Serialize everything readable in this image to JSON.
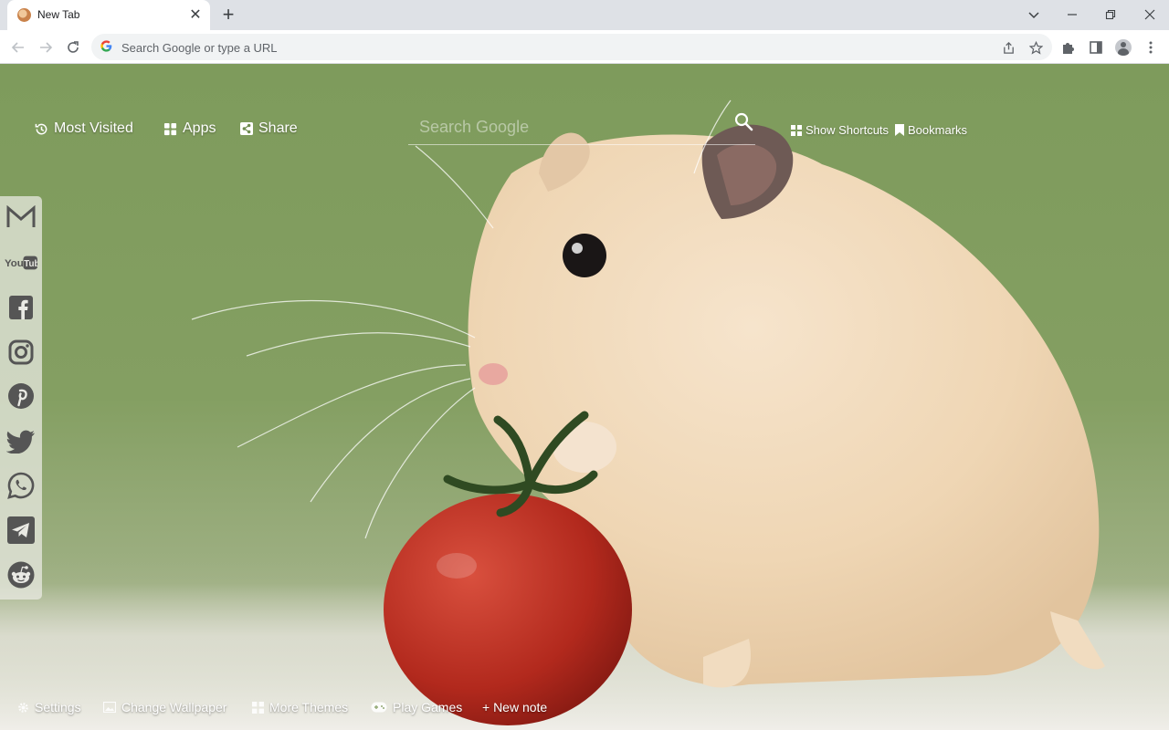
{
  "tab": {
    "title": "New Tab",
    "close": "✕"
  },
  "newtab": {
    "label": "+"
  },
  "omnibox": {
    "placeholder": "Search Google or type a URL",
    "logo": "G"
  },
  "topnav": {
    "most_visited": "Most Visited",
    "apps": "Apps",
    "share": "Share"
  },
  "search": {
    "placeholder": "Search Google"
  },
  "rightnav": {
    "show_shortcuts": "Show Shortcuts",
    "bookmarks": "Bookmarks"
  },
  "sidebar": {
    "items": [
      {
        "name": "gmail",
        "icon": "gmail-icon",
        "label": "M"
      },
      {
        "name": "youtube",
        "icon": "youtube-icon",
        "label": "YouTube"
      },
      {
        "name": "facebook",
        "icon": "facebook-icon",
        "label": "f"
      },
      {
        "name": "instagram",
        "icon": "instagram-icon"
      },
      {
        "name": "pinterest",
        "icon": "pinterest-icon",
        "label": "P"
      },
      {
        "name": "twitter",
        "icon": "twitter-icon"
      },
      {
        "name": "whatsapp",
        "icon": "whatsapp-icon"
      },
      {
        "name": "telegram",
        "icon": "telegram-icon"
      },
      {
        "name": "reddit",
        "icon": "reddit-icon"
      }
    ]
  },
  "bottom": {
    "settings": "Settings",
    "change_wallpaper": "Change Wallpaper",
    "more_themes": "More Themes",
    "play_games": "Play Games",
    "new_note": "+ New note"
  },
  "colors": {
    "wallpaper_green": "#7e9b5c",
    "floor": "#f2f0ec",
    "tomato": "#c0392b",
    "hamster": "#f1dcc0"
  }
}
